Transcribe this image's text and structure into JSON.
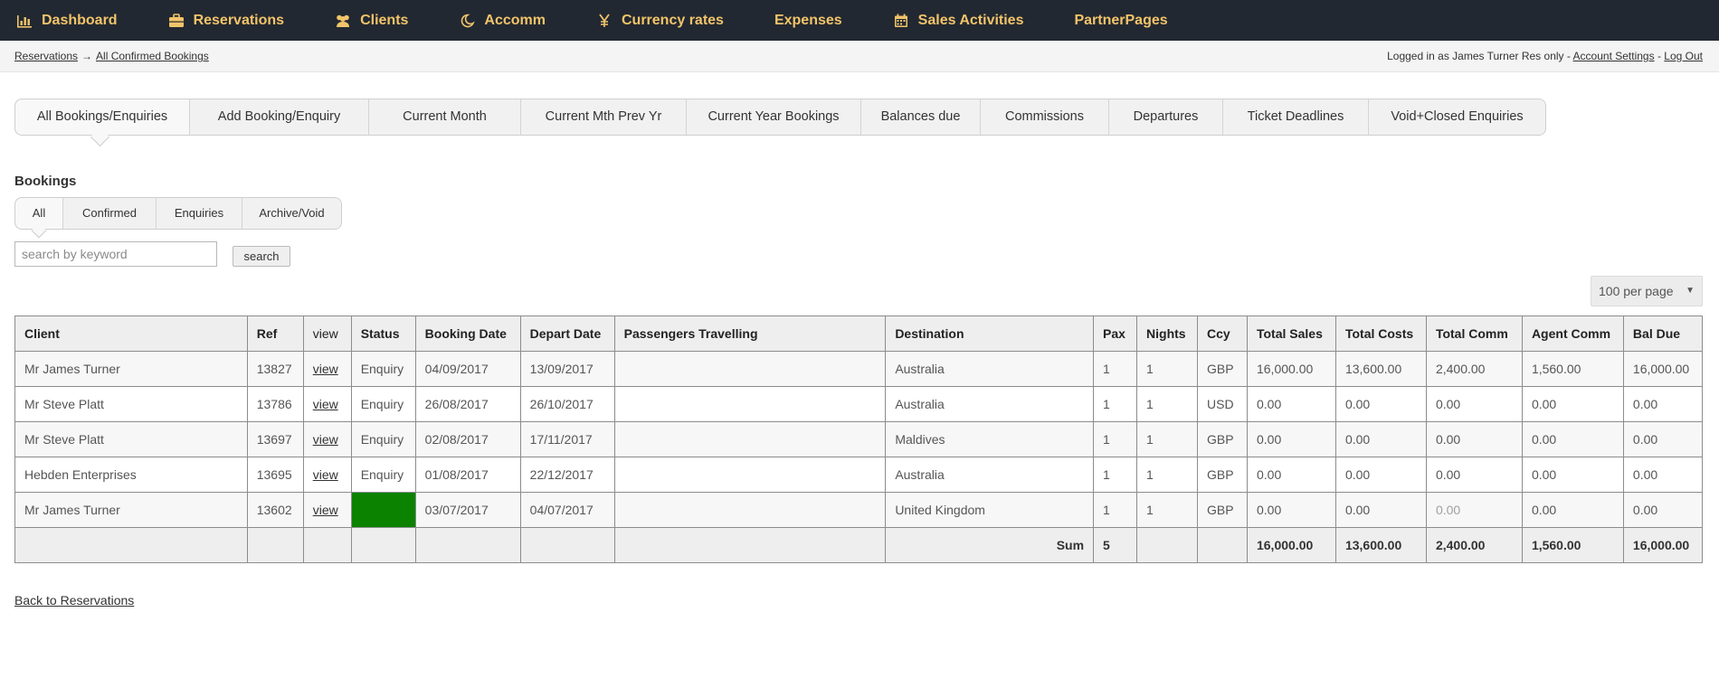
{
  "topnav": {
    "items": [
      {
        "label": "Dashboard",
        "icon": "bar-chart-icon"
      },
      {
        "label": "Reservations",
        "icon": "briefcase-icon"
      },
      {
        "label": "Clients",
        "icon": "users-icon"
      },
      {
        "label": "Accomm",
        "icon": "moon-icon"
      },
      {
        "label": "Currency rates",
        "icon": "yen-icon"
      },
      {
        "label": "Expenses",
        "icon": ""
      },
      {
        "label": "Sales Activities",
        "icon": "calendar-icon"
      },
      {
        "label": "PartnerPages",
        "icon": ""
      }
    ]
  },
  "breadcrumb": {
    "root": "Reservations",
    "arrow": "→",
    "current": "All Confirmed Bookings"
  },
  "user": {
    "logged_in_text": "Logged in as James Turner Res only -",
    "settings": "Account Settings",
    "separator": "-",
    "logout": "Log Out"
  },
  "main_tabs": [
    "All Bookings/Enquiries",
    "Add Booking/Enquiry",
    "Current Month",
    "Current Mth Prev Yr",
    "Current Year Bookings",
    "Balances due",
    "Commissions",
    "Departures",
    "Ticket Deadlines",
    "Void+Closed Enquiries"
  ],
  "section_title": "Bookings",
  "sub_tabs": [
    "All",
    "Confirmed",
    "Enquiries",
    "Archive/Void"
  ],
  "search": {
    "placeholder": "search by keyword",
    "value": "",
    "button": "search"
  },
  "per_page": {
    "selected": "100 per page",
    "caret": "▼"
  },
  "table": {
    "columns": [
      "Client",
      "Ref",
      "view",
      "Status",
      "Booking Date",
      "Depart Date",
      "Passengers Travelling",
      "Destination",
      "Pax",
      "Nights",
      "Ccy",
      "Total Sales",
      "Total Costs",
      "Total Comm",
      "Agent Comm",
      "Bal Due"
    ],
    "rows": [
      {
        "client": "Mr James Turner",
        "ref": "13827",
        "view": "view",
        "status": "Enquiry",
        "booking_date": "04/09/2017",
        "depart_date": "13/09/2017",
        "passengers": "",
        "destination": "Australia",
        "pax": "1",
        "nights": "1",
        "ccy": "GBP",
        "total_sales": "16,000.00",
        "total_costs": "13,600.00",
        "total_comm": "2,400.00",
        "agent_comm": "1,560.00",
        "bal_due": "16,000.00"
      },
      {
        "client": "Mr Steve Platt",
        "ref": "13786",
        "view": "view",
        "status": "Enquiry",
        "booking_date": "26/08/2017",
        "depart_date": "26/10/2017",
        "passengers": "",
        "destination": "Australia",
        "pax": "1",
        "nights": "1",
        "ccy": "USD",
        "total_sales": "0.00",
        "total_costs": "0.00",
        "total_comm": "0.00",
        "agent_comm": "0.00",
        "bal_due": "0.00"
      },
      {
        "client": "Mr Steve Platt",
        "ref": "13697",
        "view": "view",
        "status": "Enquiry",
        "booking_date": "02/08/2017",
        "depart_date": "17/11/2017",
        "passengers": "",
        "destination": "Maldives",
        "pax": "1",
        "nights": "1",
        "ccy": "GBP",
        "total_sales": "0.00",
        "total_costs": "0.00",
        "total_comm": "0.00",
        "agent_comm": "0.00",
        "bal_due": "0.00"
      },
      {
        "client": "Hebden Enterprises",
        "ref": "13695",
        "view": "view",
        "status": "Enquiry",
        "booking_date": "01/08/2017",
        "depart_date": "22/12/2017",
        "passengers": "",
        "destination": "Australia",
        "pax": "1",
        "nights": "1",
        "ccy": "GBP",
        "total_sales": "0.00",
        "total_costs": "0.00",
        "total_comm": "0.00",
        "agent_comm": "0.00",
        "bal_due": "0.00"
      },
      {
        "client": "Mr James Turner",
        "ref": "13602",
        "view": "view",
        "status": "",
        "booking_date": "03/07/2017",
        "depart_date": "04/07/2017",
        "passengers": "",
        "destination": "United Kingdom",
        "pax": "1",
        "nights": "1",
        "ccy": "GBP",
        "total_sales": "0.00",
        "total_costs": "0.00",
        "total_comm": "0.00",
        "agent_comm": "0.00",
        "bal_due": "0.00"
      }
    ],
    "footer": {
      "sum_label": "Sum",
      "pax": "5",
      "total_sales": "16,000.00",
      "total_costs": "13,600.00",
      "total_comm": "2,400.00",
      "agent_comm": "1,560.00",
      "bal_due": "16,000.00"
    }
  },
  "back_link": "Back to Reservations",
  "colors": {
    "nav_bg": "#222831",
    "nav_text": "#f2c46a",
    "status_confirmed": "#0b8300"
  }
}
